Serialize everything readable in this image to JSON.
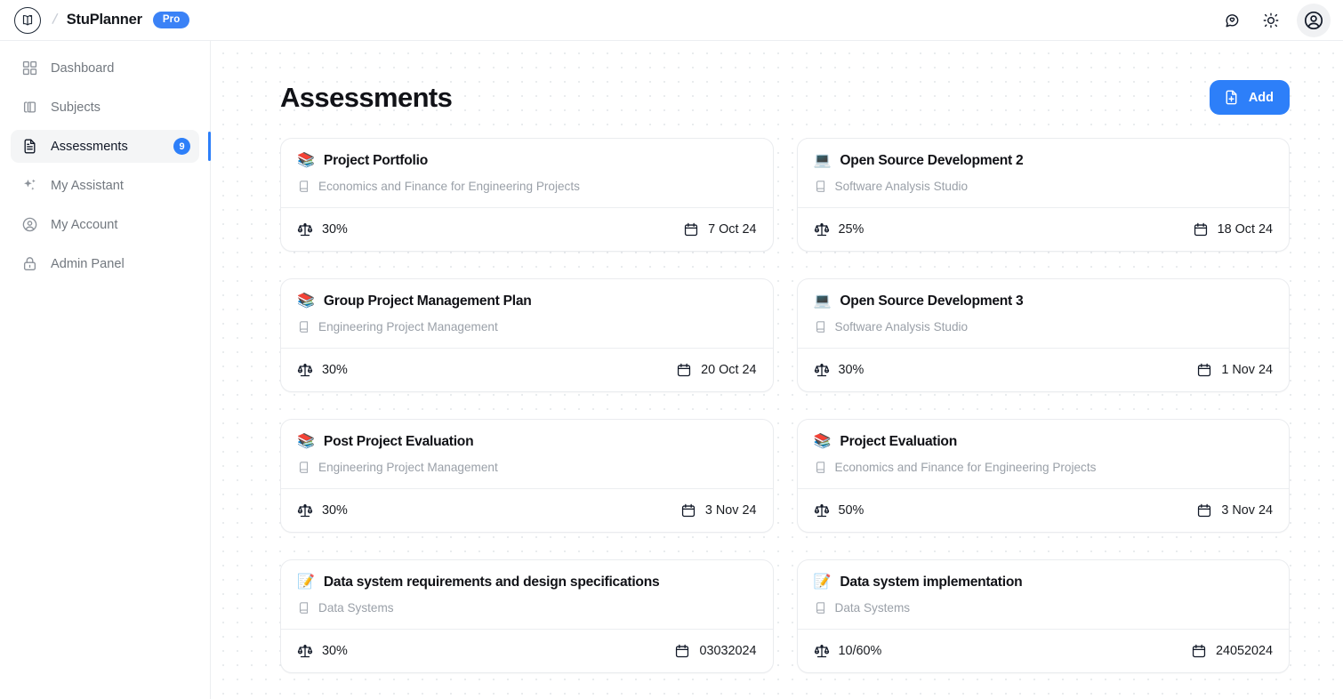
{
  "topbar": {
    "logo_icon": "open-book-logo-icon",
    "separator": "/",
    "brand_name": "StuPlanner",
    "pro_badge": "Pro",
    "actions": [
      {
        "name": "feedback-chat-icon",
        "label": "Feedback"
      },
      {
        "name": "theme-sun-icon",
        "label": "Toggle theme"
      },
      {
        "name": "user-avatar-icon",
        "label": "Account"
      }
    ]
  },
  "sidebar": {
    "items": [
      {
        "label": "Dashboard",
        "icon": "grid-icon",
        "active": false,
        "badge": null
      },
      {
        "label": "Subjects",
        "icon": "books-copy-icon",
        "active": false,
        "badge": null
      },
      {
        "label": "Assessments",
        "icon": "document-icon",
        "active": true,
        "badge": "9"
      },
      {
        "label": "My Assistant",
        "icon": "sparkles-icon",
        "active": false,
        "badge": null
      },
      {
        "label": "My Account",
        "icon": "user-circle-icon",
        "active": false,
        "badge": null
      },
      {
        "label": "Admin Panel",
        "icon": "lock-icon",
        "active": false,
        "badge": null
      }
    ]
  },
  "main": {
    "title": "Assessments",
    "add_button": {
      "label": "Add",
      "icon": "document-plus-icon"
    },
    "meta_icons": {
      "weight": "scales-icon",
      "date": "calendar-icon",
      "subject": "book-icon"
    },
    "cards": [
      {
        "emoji": "📚",
        "emoji_name": "books-emoji",
        "title": "Project Portfolio",
        "subject": "Economics and Finance for Engineering Projects",
        "weight": "30%",
        "date": "7 Oct 24"
      },
      {
        "emoji": "💻",
        "emoji_name": "laptop-emoji",
        "title": "Open Source Development 2",
        "subject": "Software Analysis Studio",
        "weight": "25%",
        "date": "18 Oct 24"
      },
      {
        "emoji": "📚",
        "emoji_name": "books-emoji",
        "title": "Group Project Management Plan",
        "subject": "Engineering Project Management",
        "weight": "30%",
        "date": "20 Oct 24"
      },
      {
        "emoji": "💻",
        "emoji_name": "laptop-emoji",
        "title": "Open Source Development 3",
        "subject": "Software Analysis Studio",
        "weight": "30%",
        "date": "1 Nov 24"
      },
      {
        "emoji": "📚",
        "emoji_name": "books-emoji",
        "title": "Post Project Evaluation",
        "subject": "Engineering Project Management",
        "weight": "30%",
        "date": "3 Nov 24"
      },
      {
        "emoji": "📚",
        "emoji_name": "books-emoji",
        "title": "Project Evaluation",
        "subject": "Economics and Finance for Engineering Projects",
        "weight": "50%",
        "date": "3 Nov 24"
      },
      {
        "emoji": "📝",
        "emoji_name": "memo-emoji",
        "title": "Data system requirements and design specifications",
        "subject": "Data Systems",
        "weight": "30%",
        "date": "03032024"
      },
      {
        "emoji": "📝",
        "emoji_name": "memo-emoji",
        "title": "Data system implementation",
        "subject": "Data Systems",
        "weight": "10/60%",
        "date": "24052024"
      }
    ]
  },
  "colors": {
    "accent": "#2d7ff9",
    "badge": "#2d7ff9",
    "pro": "#3b82f6",
    "text": "#111217",
    "muted": "#9aa0a8",
    "border": "#eaecef"
  }
}
